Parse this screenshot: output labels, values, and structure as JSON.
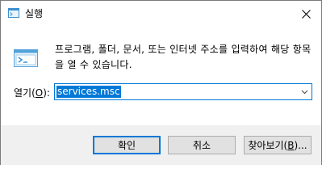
{
  "window": {
    "title": "실행",
    "close_glyph": "✕"
  },
  "dialog": {
    "description": "프로그램, 폴더, 문서, 또는 인터넷 주소를 입력하여 해당 항목을 열 수 있습니다.",
    "open_label_prefix": "열기(",
    "open_label_mnemonic": "O",
    "open_label_suffix": "):",
    "command_value": "services.msc"
  },
  "buttons": {
    "ok_label": "확인",
    "cancel_label": "취소",
    "browse_label_prefix": "찾아보기(",
    "browse_label_mnemonic": "B",
    "browse_label_suffix": ")..."
  },
  "colors": {
    "accent": "#0078d7",
    "footer_bg": "#f0f0f0"
  },
  "icons": [
    "run-app-icon",
    "close-icon",
    "run-dialog-icon",
    "chevron-down-icon"
  ]
}
